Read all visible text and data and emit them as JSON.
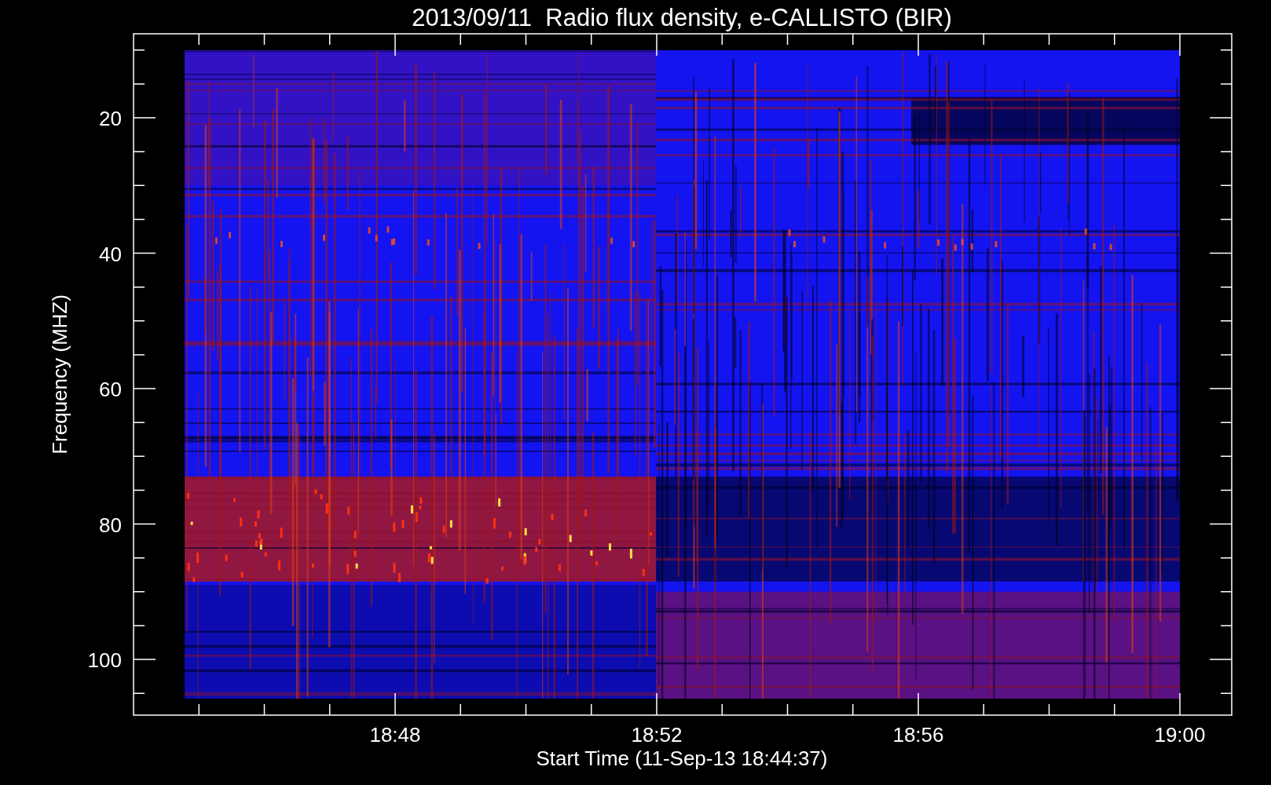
{
  "plot": {
    "title": "2013/09/11  Radio flux density, e-CALLISTO (BIR)",
    "ylabel": "Frequency (MHZ)",
    "xlabel": "Start Time (11-Sep-13 18:44:37)",
    "yticks": [
      "20",
      "40",
      "60",
      "80",
      "100"
    ],
    "xticks": [
      "18:48",
      "18:52",
      "18:56",
      "19:00"
    ]
  }
}
